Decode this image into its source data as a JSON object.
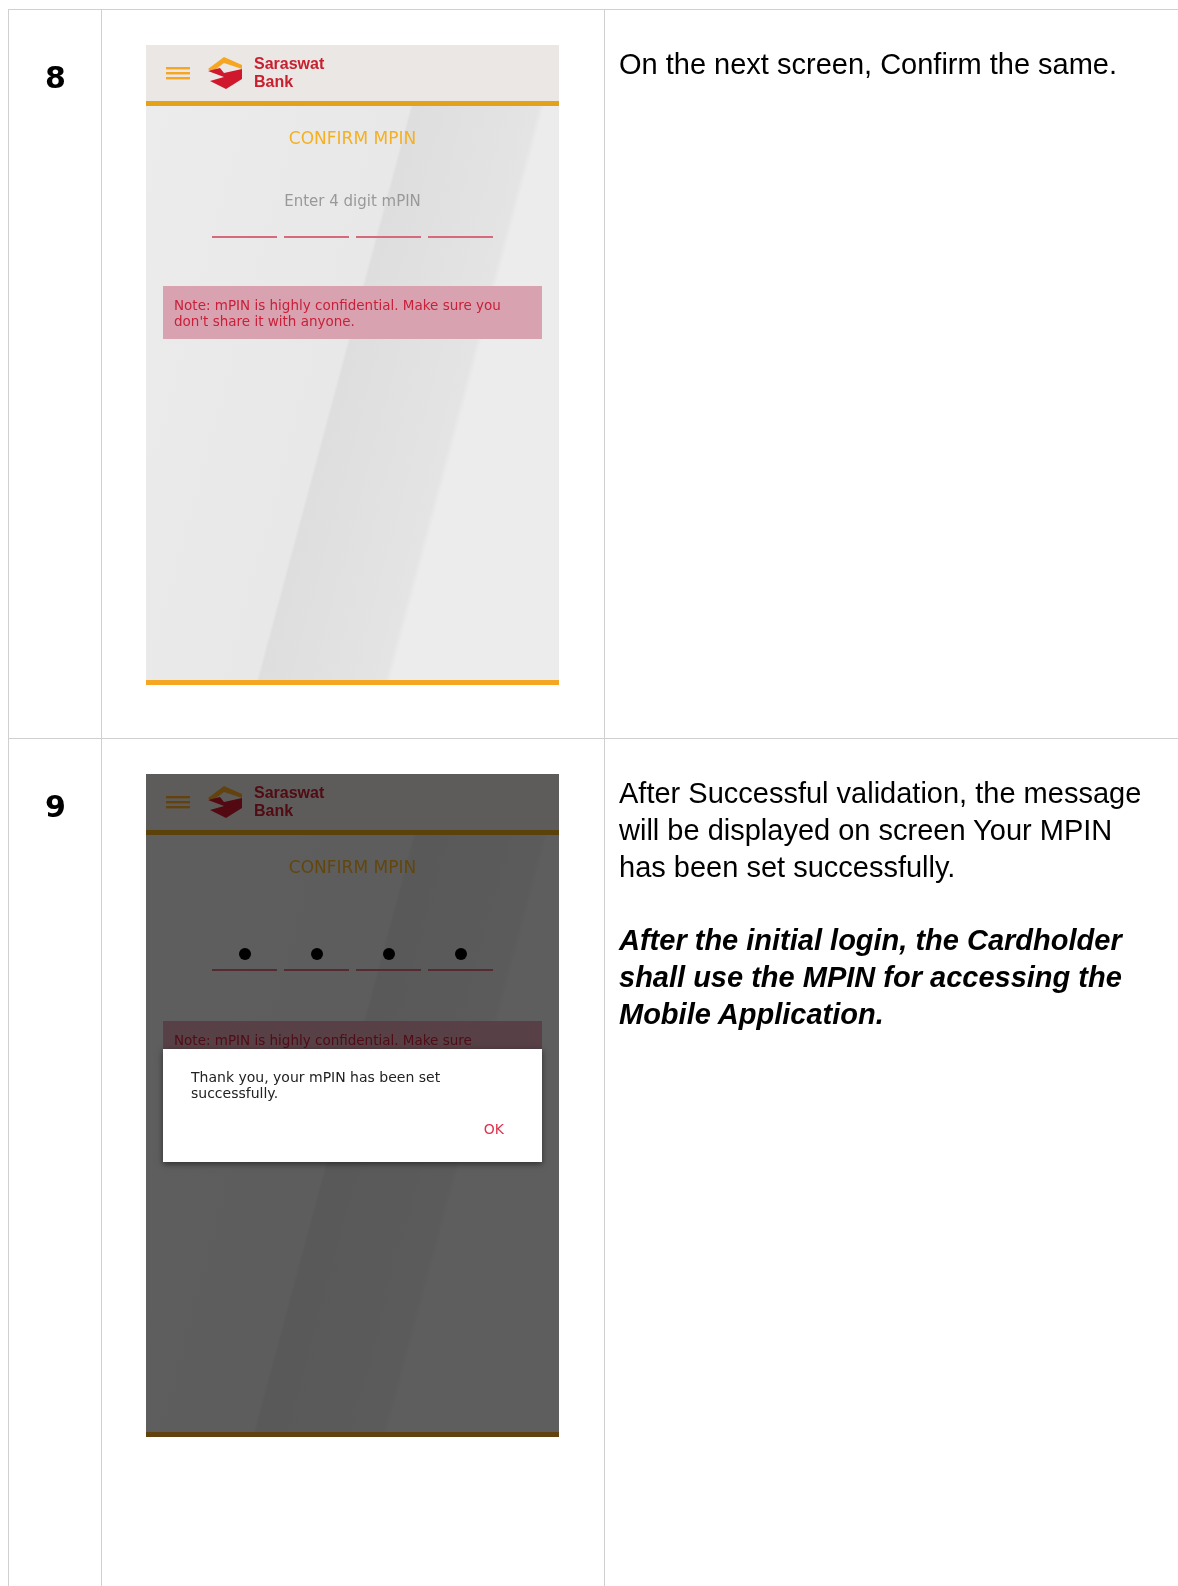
{
  "rows": [
    {
      "step": "8",
      "screen": {
        "dimmed": false,
        "brand": [
          "Saraswat",
          "Bank"
        ],
        "title": "CONFIRM MPIN",
        "placeholder": "Enter 4 digit mPIN",
        "pin_digits": [
          {
            "filled": false
          },
          {
            "filled": false
          },
          {
            "filled": false
          },
          {
            "filled": false
          }
        ],
        "note": "Note: mPIN is highly confidential. Make sure you don't share it with anyone."
      },
      "description": [
        {
          "kind": "plain",
          "text": "On the next screen, Confirm the same."
        }
      ]
    },
    {
      "step": "9",
      "screen": {
        "dimmed": true,
        "brand": [
          "Saraswat",
          "Bank"
        ],
        "title": "CONFIRM MPIN",
        "pin_digits": [
          {
            "filled": true
          },
          {
            "filled": true
          },
          {
            "filled": true
          },
          {
            "filled": true
          }
        ],
        "note": "Note: mPIN is highly confidential. Make sure",
        "dialog": {
          "message": "Thank you, your mPIN has been set successfully.",
          "button": "OK"
        }
      },
      "description": [
        {
          "kind": "plain",
          "text": "After Successful validation, the message will be displayed on screen Your MPIN has been set successfully."
        },
        {
          "kind": "emphasis",
          "text": "After the initial login, the Cardholder shall use the MPIN for accessing the Mobile Application."
        }
      ]
    }
  ]
}
